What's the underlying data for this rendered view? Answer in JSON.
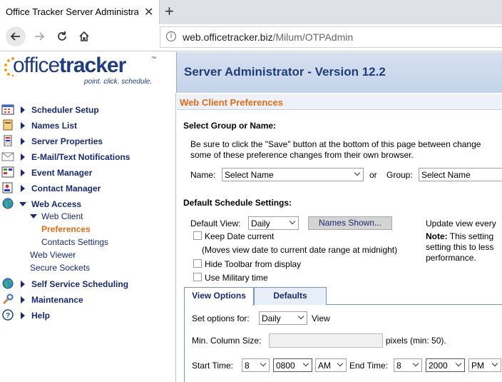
{
  "browser": {
    "tab_title": "Office Tracker Server Administration",
    "tab_close": "✕",
    "new_tab": "+",
    "url_domain": "web.officetracker.biz",
    "url_path": "/Milum/OTPAdmin"
  },
  "logo": {
    "office": "office",
    "tracker": "tracker",
    "tm": "™",
    "tagline": "point. click. schedule."
  },
  "header": {
    "title": "Server Administrator - Version 12.2"
  },
  "sidebar": {
    "items": [
      {
        "label": "Scheduler Setup",
        "icon": "calendar-icon"
      },
      {
        "label": "Names List",
        "icon": "address-book-icon"
      },
      {
        "label": "Server Properties",
        "icon": "server-icon"
      },
      {
        "label": "E-Mail/Text Notifications",
        "icon": "envelope-icon"
      },
      {
        "label": "Event Manager",
        "icon": "event-icon"
      },
      {
        "label": "Contact Manager",
        "icon": "contact-icon"
      },
      {
        "label": "Web Access",
        "icon": "globe-icon"
      },
      {
        "label": "Self Service Scheduling",
        "icon": "globe-icon"
      },
      {
        "label": "Maintenance",
        "icon": "wrench-icon"
      },
      {
        "label": "Help",
        "icon": "help-icon"
      }
    ],
    "web_access_sub": {
      "web_client": "Web Client",
      "preferences": "Preferences",
      "contacts_settings": "Contacts Settings",
      "web_viewer": "Web Viewer",
      "secure_sockets": "Secure Sockets"
    }
  },
  "content": {
    "title": "Web Client Preferences",
    "select_group_heading": "Select Group or Name:",
    "save_note_line1": "Be sure to click the \"Save\" button at the bottom of this page between change",
    "save_note_line2": "some of these preference changes from their own browser.",
    "name_label": "Name:",
    "name_value": "Select Name",
    "or_label": "or",
    "group_label": "Group:",
    "group_value": "Select Name",
    "default_schedule_heading": "Default Schedule Settings:",
    "default_view_label": "Default View:",
    "default_view_value": "Daily",
    "names_shown_button": "Names Shown...",
    "keep_date_label": "Keep Date current",
    "keep_date_note": "(Moves view date to current date range at midnight)",
    "hide_toolbar_label": "Hide Toolbar from display",
    "military_label": "Use Military time",
    "update_view_text": "Update view every",
    "note_bold": "Note:",
    "note_line1": "This setting",
    "note_line2": "setting this to less",
    "note_line3": "performance.",
    "tabs": {
      "view_options": "View Options",
      "defaults": "Defaults"
    },
    "set_options_label": "Set options for:",
    "set_options_value": "Daily",
    "view_label": "View",
    "min_col_label": "Min. Column Size:",
    "pixels_label": "pixels (min: 50).",
    "start_time_label": "Start Time:",
    "start_hour": "8",
    "start_time": "0800",
    "start_ampm": "AM",
    "end_time_label": "End Time:",
    "end_hour": "8",
    "end_time": "2000",
    "end_ampm": "PM"
  }
}
